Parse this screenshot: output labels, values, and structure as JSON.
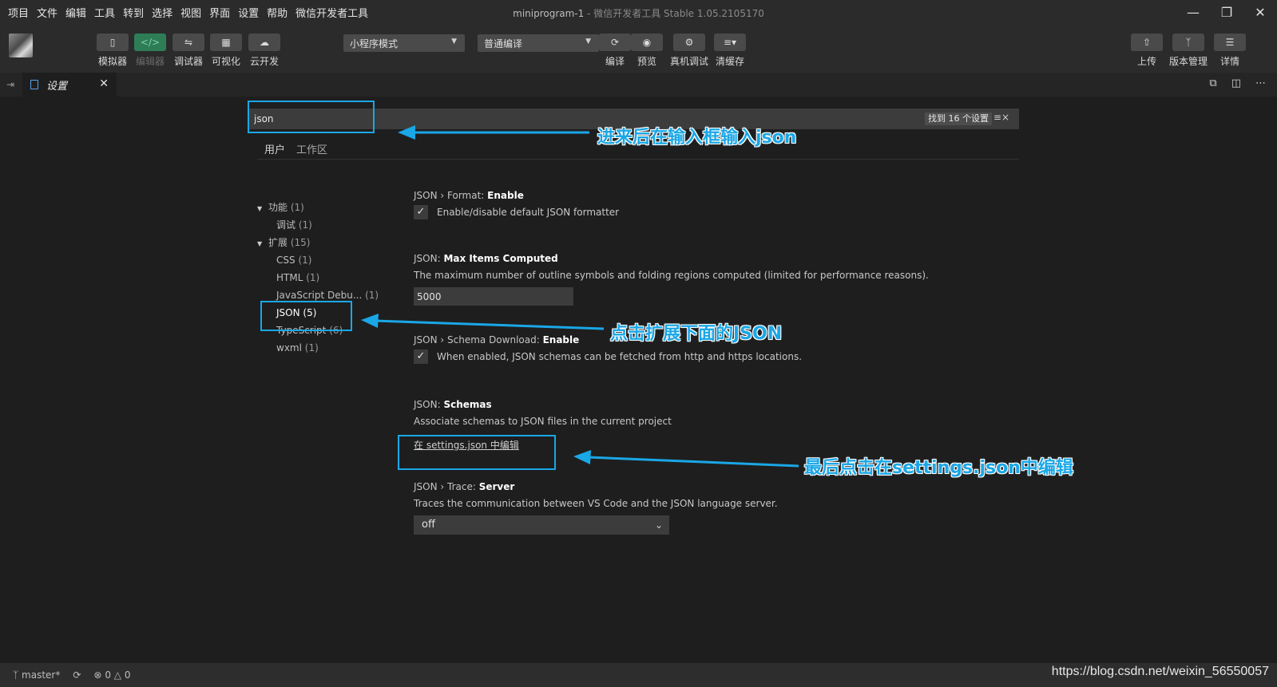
{
  "menubar": {
    "items": [
      "项目",
      "文件",
      "编辑",
      "工具",
      "转到",
      "选择",
      "视图",
      "界面",
      "设置",
      "帮助",
      "微信开发者工具"
    ],
    "title_main": "miniprogram-1",
    "title_sub": " - 微信开发者工具 Stable 1.05.2105170"
  },
  "toolbar": {
    "simulator": "模拟器",
    "editor": "编辑器",
    "debugger": "调试器",
    "visual": "可视化",
    "cloud": "云开发",
    "mode_select": "小程序模式",
    "compile_select": "普通编译",
    "compile": "编译",
    "preview": "预览",
    "real_debug": "真机调试",
    "clear_cache": "清缓存",
    "upload": "上传",
    "version": "版本管理",
    "details": "详情"
  },
  "tabbar": {
    "tab_label": "设置"
  },
  "search": {
    "value": "json",
    "found": "找到 16 个设置"
  },
  "scope": {
    "user": "用户",
    "workspace": "工作区"
  },
  "toc": [
    {
      "label": "功能",
      "count": "(1)",
      "level": 0,
      "expanded": true
    },
    {
      "label": "调试",
      "count": "(1)",
      "level": 1
    },
    {
      "label": "扩展",
      "count": "(15)",
      "level": 0,
      "expanded": true
    },
    {
      "label": "CSS",
      "count": "(1)",
      "level": 1
    },
    {
      "label": "HTML",
      "count": "(1)",
      "level": 1
    },
    {
      "label": "JavaScript Debu...",
      "count": "(1)",
      "level": 1
    },
    {
      "label": "JSON",
      "count": "(5)",
      "level": 1
    },
    {
      "label": "TypeScript",
      "count": "(6)",
      "level": 1
    },
    {
      "label": "wxml",
      "count": "(1)",
      "level": 1
    }
  ],
  "settings": {
    "format": {
      "category": "JSON › Format: ",
      "name": "Enable",
      "desc": "Enable/disable default JSON formatter",
      "checked": true
    },
    "max_items": {
      "category": "JSON: ",
      "name": "Max Items Computed",
      "desc": "The maximum number of outline symbols and folding regions computed (limited for performance reasons).",
      "value": "5000"
    },
    "schema_download": {
      "category": "JSON › Schema Download: ",
      "name": "Enable",
      "desc": "When enabled, JSON schemas can be fetched from http and https locations.",
      "checked": true
    },
    "schemas": {
      "category": "JSON: ",
      "name": "Schemas",
      "desc": "Associate schemas to JSON files in the current project",
      "link": "在 settings.json 中编辑"
    },
    "trace": {
      "category": "JSON › Trace: ",
      "name": "Server",
      "desc": "Traces the communication between VS Code and the JSON language server.",
      "value": "off"
    }
  },
  "annotations": {
    "a1": "进来后在输入框输入json",
    "a2": "点击扩展下面的JSON",
    "a3": "最后点击在settings.json中编辑",
    "color": "#1aa7e6"
  },
  "statusbar": {
    "branch": "master*",
    "problems": "0",
    "warnings": "0"
  },
  "watermark": "https://blog.csdn.net/weixin_56550057",
  "icons": {
    "close": "close-icon",
    "chevron": "chevron-down-icon",
    "check": "check-icon"
  }
}
